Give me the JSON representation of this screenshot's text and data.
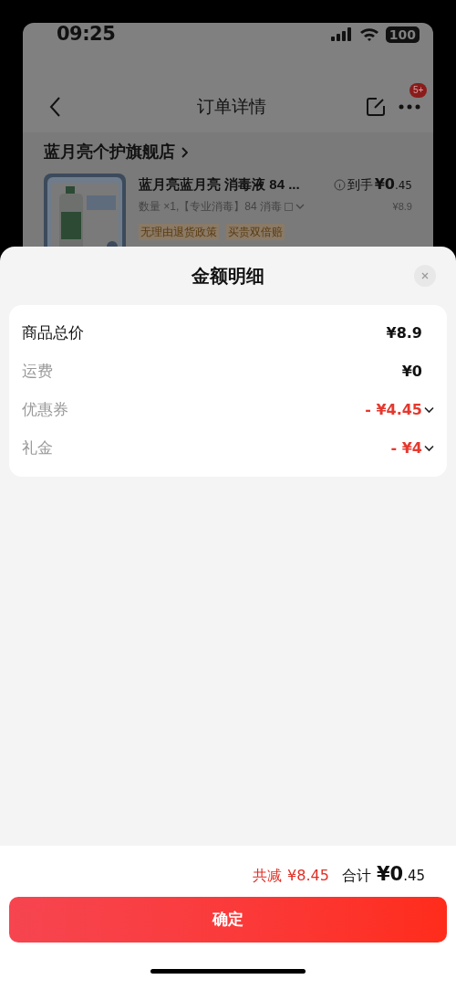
{
  "status_bar": {
    "time": "09:25",
    "battery": "100"
  },
  "nav": {
    "title": "订单详情",
    "badge": "5+"
  },
  "store": {
    "name": "蓝月亮个护旗舰店"
  },
  "product": {
    "title": "蓝月亮蓝月亮 消毒液 84 ...",
    "price_label": "到手",
    "price": "¥0.45",
    "spec": "数量 ×1,【专业消毒】84 消毒",
    "original_price": "¥8.9",
    "tags": [
      "无理由退货政策",
      "买贵双倍赔"
    ]
  },
  "sheet": {
    "title": "金额明细",
    "rows": [
      {
        "label": "商品总价",
        "value": "¥8.9",
        "kind": "plain",
        "emphasis": true
      },
      {
        "label": "运费",
        "value": "¥0",
        "kind": "plain",
        "emphasis": false
      },
      {
        "label": "优惠券",
        "value": "- ¥4.45",
        "kind": "discount",
        "emphasis": false
      },
      {
        "label": "礼金",
        "value": "- ¥4",
        "kind": "discount",
        "emphasis": false
      }
    ]
  },
  "summary": {
    "reduction_label": "共减",
    "reduction": "¥8.45",
    "total_label": "合计",
    "total": "¥0.45"
  },
  "confirm_button": "确定"
}
